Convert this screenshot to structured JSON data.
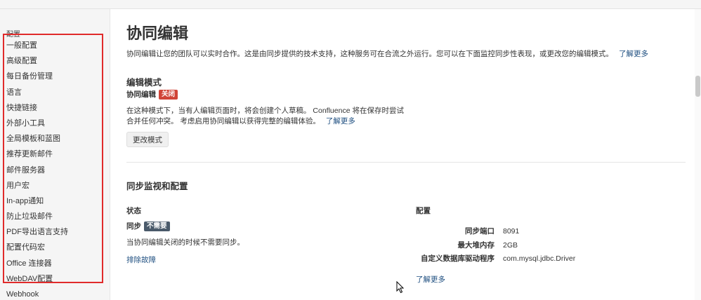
{
  "sidebar": {
    "section_label": "配置",
    "items": [
      {
        "label": "一般配置"
      },
      {
        "label": "高级配置"
      },
      {
        "label": "每日备份管理"
      },
      {
        "label": "语言"
      },
      {
        "label": "快捷链接"
      },
      {
        "label": "外部小工具"
      },
      {
        "label": "全局模板和蓝图"
      },
      {
        "label": "推荐更新邮件"
      },
      {
        "label": "邮件服务器"
      },
      {
        "label": "用户宏"
      },
      {
        "label": "In-app通知"
      },
      {
        "label": "防止垃圾邮件"
      },
      {
        "label": "PDF导出语言支持"
      },
      {
        "label": "配置代码宏"
      },
      {
        "label": "Office 连接器"
      },
      {
        "label": "WebDAV配置"
      },
      {
        "label": "Webhook"
      }
    ],
    "highlight_color": "#e02b2b"
  },
  "main": {
    "title": "协同编辑",
    "intro": "协同编辑让您的团队可以实时合作。这是由同步提供的技术支持，这种服务可在合流之外运行。您可以在下面监控同步性表现，或更改您的编辑模式。",
    "intro_link": "了解更多",
    "edit_mode": {
      "heading": "编辑模式",
      "collab_label": "协同编辑",
      "collab_status": "关闭",
      "desc_line1": "在这种模式下，当有人编辑页面时，将会创建个人草稿。 Confluence 将在保存时尝试",
      "desc_line2": "合并任何冲突。 考虑启用协同编辑以获得完整的编辑体验。",
      "desc_link": "了解更多",
      "change_button": "更改模式"
    },
    "sync": {
      "heading": "同步监视和配置",
      "status_heading": "状态",
      "sync_label": "同步",
      "sync_status": "不需要",
      "sync_note": "当协同编辑关闭的时候不需要同步。",
      "troubleshoot_link": "排除故障",
      "config_heading": "配置",
      "config": [
        {
          "key": "同步端口",
          "value": "8091"
        },
        {
          "key": "最大堆内存",
          "value": "2GB"
        },
        {
          "key": "自定义数据库驱动程序",
          "value": "com.mysql.jdbc.Driver"
        }
      ],
      "config_link": "了解更多"
    }
  },
  "colors": {
    "link": "#205081",
    "lozenge_off": "#d04437",
    "lozenge_not_needed": "#4a5a6a"
  }
}
